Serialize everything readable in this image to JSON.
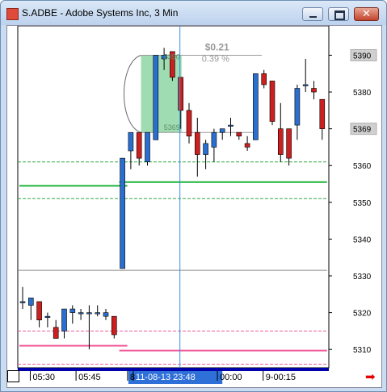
{
  "window": {
    "title": "S.ADBE - Adobe Systems Inc, 3 Min"
  },
  "price_axis": {
    "ticks": [
      {
        "price": 5390,
        "label": "5390",
        "boxed": true
      },
      {
        "price": 5380,
        "label": "5380"
      },
      {
        "price": 5370,
        "label": "5369",
        "boxed": true
      },
      {
        "price": 5360,
        "label": "5360"
      },
      {
        "price": 5350,
        "label": "5350"
      },
      {
        "price": 5340,
        "label": "5340"
      },
      {
        "price": 5330,
        "label": "5330"
      },
      {
        "price": 5320,
        "label": "5320"
      },
      {
        "price": 5310,
        "label": "5310"
      }
    ]
  },
  "time_axis": {
    "labels": [
      "05:30",
      "05:45",
      "8",
      "11-08-13 23:48",
      "00:00",
      "9-00:15"
    ],
    "cursor_label": "11-08-13 23:48"
  },
  "measure": {
    "change": "$0.21",
    "percent": "0.39 %",
    "low_label": "5369",
    "high_label": "5390"
  },
  "colors": {
    "up": "#2a6fcf",
    "down": "#cc1f1f",
    "ma_green": "#1fb33a",
    "band_green": "#33a845",
    "pink": "#f05b9c",
    "cursor": "#3b8fe0",
    "highlight": "#8fd6a3",
    "nav_arrow": "#e60000"
  },
  "chart_data": {
    "type": "candlestick",
    "title": "S.ADBE - Adobe Systems Inc, 3 Min",
    "ylim": [
      5305,
      5398
    ],
    "candles": [
      {
        "o": 5323,
        "h": 5327,
        "l": 5321,
        "c": 5323
      },
      {
        "o": 5322,
        "h": 5324,
        "l": 5318,
        "c": 5324
      },
      {
        "o": 5323,
        "h": 5323,
        "l": 5316,
        "c": 5318
      },
      {
        "o": 5319,
        "h": 5320,
        "l": 5316,
        "c": 5319
      },
      {
        "o": 5316,
        "h": 5318,
        "l": 5313,
        "c": 5313
      },
      {
        "o": 5315,
        "h": 5321,
        "l": 5313,
        "c": 5321
      },
      {
        "o": 5320,
        "h": 5322,
        "l": 5317,
        "c": 5321
      },
      {
        "o": 5320,
        "h": 5321,
        "l": 5318,
        "c": 5320
      },
      {
        "o": 5320,
        "h": 5322,
        "l": 5310,
        "c": 5320
      },
      {
        "o": 5320,
        "h": 5322,
        "l": 5319,
        "c": 5320
      },
      {
        "o": 5319,
        "h": 5321,
        "l": 5318,
        "c": 5320
      },
      {
        "o": 5319,
        "h": 5319,
        "l": 5313,
        "c": 5314
      },
      {
        "o": 5332,
        "h": 5362,
        "l": 5332,
        "c": 5362
      },
      {
        "o": 5364,
        "h": 5369,
        "l": 5359,
        "c": 5369
      },
      {
        "o": 5369,
        "h": 5369,
        "l": 5360,
        "c": 5362
      },
      {
        "o": 5361,
        "h": 5369,
        "l": 5360,
        "c": 5369
      },
      {
        "o": 5367,
        "h": 5390,
        "l": 5367,
        "c": 5390
      },
      {
        "o": 5389,
        "h": 5392,
        "l": 5386,
        "c": 5390
      },
      {
        "o": 5391,
        "h": 5391,
        "l": 5383,
        "c": 5384
      },
      {
        "o": 5384,
        "h": 5384,
        "l": 5370,
        "c": 5375
      },
      {
        "o": 5375,
        "h": 5377,
        "l": 5366,
        "c": 5368
      },
      {
        "o": 5369,
        "h": 5373,
        "l": 5357,
        "c": 5363
      },
      {
        "o": 5363,
        "h": 5367,
        "l": 5359,
        "c": 5366
      },
      {
        "o": 5365,
        "h": 5370,
        "l": 5361,
        "c": 5369
      },
      {
        "o": 5369,
        "h": 5370,
        "l": 5367,
        "c": 5370
      },
      {
        "o": 5371,
        "h": 5373,
        "l": 5368,
        "c": 5371
      },
      {
        "o": 5369,
        "h": 5369,
        "l": 5367,
        "c": 5368
      },
      {
        "o": 5366,
        "h": 5368,
        "l": 5364,
        "c": 5365
      },
      {
        "o": 5367,
        "h": 5385,
        "l": 5367,
        "c": 5385
      },
      {
        "o": 5385,
        "h": 5386,
        "l": 5381,
        "c": 5382
      },
      {
        "o": 5383,
        "h": 5383,
        "l": 5371,
        "c": 5372
      },
      {
        "o": 5370,
        "h": 5377,
        "l": 5361,
        "c": 5363
      },
      {
        "o": 5370,
        "h": 5370,
        "l": 5360,
        "c": 5362
      },
      {
        "o": 5371,
        "h": 5382,
        "l": 5367,
        "c": 5381
      },
      {
        "o": 5382,
        "h": 5389,
        "l": 5380,
        "c": 5382
      },
      {
        "o": 5381,
        "h": 5383,
        "l": 5378,
        "c": 5380
      },
      {
        "o": 5378,
        "h": 5378,
        "l": 5367,
        "c": 5370
      }
    ],
    "ma_line": [
      {
        "from": 0,
        "to": 12,
        "y": 5354.5
      },
      {
        "from": 12,
        "to": 36,
        "y": 5355.5
      }
    ],
    "green_bands": [
      {
        "from": 0,
        "to": 36,
        "y": 5361
      },
      {
        "from": 0,
        "to": 36,
        "y": 5351
      }
    ],
    "pink_line": [
      {
        "from": 0,
        "to": 12,
        "y": 5311
      },
      {
        "from": 12,
        "to": 36,
        "y": 5309.7
      }
    ],
    "pink_bands": [
      {
        "from": 0,
        "to": 36,
        "y": 5315
      },
      {
        "from": 0,
        "to": 36,
        "y": 5306
      }
    ],
    "gray_line": 5331.5
  }
}
